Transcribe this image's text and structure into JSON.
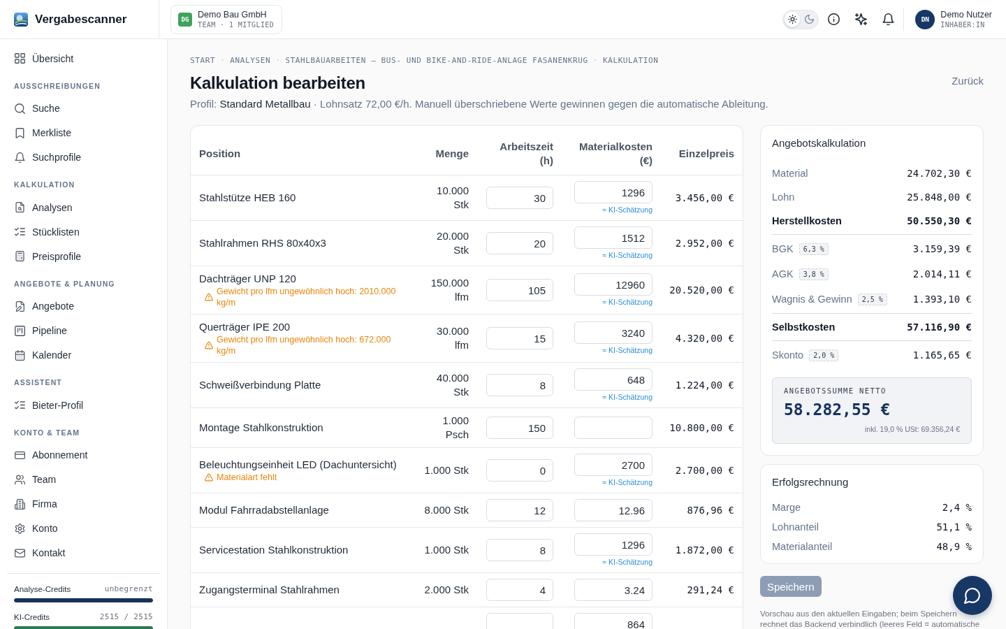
{
  "app": {
    "name": "Vergabescanner"
  },
  "org_switcher": {
    "initials": "DG",
    "name": "Demo Bau GmbH",
    "meta": "TEAM · 1 MITGLIED"
  },
  "theme_toggle": [
    {
      "kind": "light",
      "selected": true
    },
    {
      "kind": "dark",
      "selected": false
    }
  ],
  "user": {
    "initials": "DN",
    "name": "Demo Nutzer",
    "role": "INHABER:IN"
  },
  "sidebar": {
    "sections": [
      {
        "items": [
          "Übersicht"
        ]
      },
      {
        "heading": "AUSSCHREIBUNGEN",
        "items": [
          "Suche",
          "Merkliste",
          "Suchprofile"
        ]
      },
      {
        "heading": "KALKULATION",
        "items": [
          "Analysen",
          "Stücklisten",
          "Preisprofile"
        ]
      },
      {
        "heading": "ANGEBOTE & PLANUNG",
        "items": [
          "Angebote",
          "Pipeline",
          "Kalender"
        ]
      },
      {
        "heading": "ASSISTENT",
        "items": [
          "Bieter-Profil"
        ]
      },
      {
        "heading": "KONTO & TEAM",
        "items": [
          "Abonnement",
          "Team",
          "Firma",
          "Konto",
          "Kontakt"
        ]
      }
    ],
    "credits": [
      {
        "label": "Analyse-Credits",
        "value": "unbegrenzt",
        "level": 1,
        "color": "#15325e"
      },
      {
        "label": "KI-Credits",
        "value": "2515 / 2515",
        "level": 1,
        "color": "#2b7a52"
      }
    ]
  },
  "breadcrumb": {
    "separator": "·",
    "items": [
      "START",
      "ANALYSEN",
      "STAHLBAUARBEITEN — BUS- UND BIKE-AND-RIDE-ANLAGE FASANENKRUG",
      "KALKULATION"
    ]
  },
  "title": "Kalkulation bearbeiten",
  "subtitle": {
    "label": "Profil:",
    "profile": "Standard Metallbau",
    "text": "· Lohnsatz 72,00 €/h. Manuell überschriebene Werte gewinnen gegen die automatische Ableitung."
  },
  "back_link": "Zurück",
  "table": {
    "columns": [
      "Position",
      "Menge",
      "Arbeitszeit (h)",
      "Materialkosten (€)",
      "Einzelpreis"
    ],
    "rows": [
      {
        "position": "Stahlstütze HEB 160",
        "quantity": "10.000 Stk",
        "labor_hours": "30",
        "material_cost": "1296",
        "hint": "≈ KI-Schätzung",
        "unit_price": "3.456,00 €"
      },
      {
        "position": "Stahlrahmen RHS 80x40x3",
        "quantity": "20.000 Stk",
        "labor_hours": "20",
        "material_cost": "1512",
        "hint": "≈ KI-Schätzung",
        "unit_price": "2.952,00 €"
      },
      {
        "position": "Dachträger UNP 120",
        "warning": "Gewicht pro lfm ungewöhnlich hoch: 2010.000 kg/m",
        "quantity": "150.000 lfm",
        "labor_hours": "105",
        "material_cost": "12960",
        "hint": "≈ KI-Schätzung",
        "unit_price": "20.520,00 €"
      },
      {
        "position": "Querträger IPE 200",
        "warning": "Gewicht pro lfm ungewöhnlich hoch: 672.000 kg/m",
        "quantity": "30.000 lfm",
        "labor_hours": "15",
        "material_cost": "3240",
        "hint": "≈ KI-Schätzung",
        "unit_price": "4.320,00 €"
      },
      {
        "position": "Schweißverbindung Platte",
        "quantity": "40.000 Stk",
        "labor_hours": "8",
        "material_cost": "648",
        "hint": "≈ KI-Schätzung",
        "unit_price": "1.224,00 €"
      },
      {
        "position": "Montage Stahlkonstruktion",
        "quantity": "1.000 Psch",
        "labor_hours": "150",
        "unit_price": "10.800,00 €"
      },
      {
        "position": "Beleuchtungseinheit LED (Dachuntersicht)",
        "warning": "Materialart fehlt",
        "quantity": "1.000 Stk",
        "labor_hours": "0",
        "material_cost": "2700",
        "hint": "≈ KI-Schätzung",
        "unit_price": "2.700,00 €"
      },
      {
        "position": "Modul Fahrradabstellanlage",
        "quantity": "8.000 Stk",
        "labor_hours": "12",
        "material_cost": "12.96",
        "unit_price": "876,96 €"
      },
      {
        "position": "Servicestation Stahlkonstruktion",
        "quantity": "1.000 Stk",
        "labor_hours": "8",
        "material_cost": "1296",
        "hint": "≈ KI-Schätzung",
        "unit_price": "1.872,00 €"
      },
      {
        "position": "Zugangsterminal Stahlrahmen",
        "quantity": "2.000 Stk",
        "labor_hours": "4",
        "material_cost": "3.24",
        "unit_price": "291,24 €"
      },
      {
        "material_cost": "864"
      }
    ]
  },
  "offer_calculation": {
    "title": "Angebotskalkulation",
    "groups": [
      {
        "rows": [
          {
            "kind": "item",
            "label": "Material",
            "value": "24.702,30 €"
          },
          {
            "kind": "item",
            "label": "Lohn",
            "value": "25.848,00 €"
          },
          {
            "kind": "total",
            "label": "Herstellkosten",
            "value": "50.550,30 €"
          }
        ]
      },
      {
        "rows": [
          {
            "kind": "item",
            "label": "BGK",
            "rate": "6,3 %",
            "value": "3.159,39 €"
          },
          {
            "kind": "item",
            "label": "AGK",
            "rate": "3,8 %",
            "value": "2.014,11 €"
          },
          {
            "kind": "item",
            "label": "Wagnis & Gewinn",
            "rate": "2,5 %",
            "value": "1.393,10 €"
          }
        ]
      },
      {
        "rows": [
          {
            "kind": "total",
            "label": "Selbstkosten",
            "value": "57.116,90 €"
          }
        ]
      },
      {
        "rows": [
          {
            "kind": "item",
            "label": "Skonto",
            "rate": "2,0 %",
            "value": "1.165,65 €"
          }
        ]
      }
    ],
    "net_total": {
      "label": "ANGEBOTSSUMME NETTO",
      "value": "58.282,55 €",
      "vat_note": "inkl. 19,0 % USt: 69.356,24 €"
    }
  },
  "result": {
    "title": "Erfolgsrechnung",
    "rows": [
      {
        "label": "Marge",
        "value": "2,4 %"
      },
      {
        "label": "Lohnanteil",
        "value": "51,1 %"
      },
      {
        "label": "Materialanteil",
        "value": "48,9 %"
      }
    ]
  },
  "save_button": {
    "label": "Speichern",
    "disabled": true
  },
  "save_note": "Vorschau aus den aktuellen Eingaben; beim Speichern rechnet das Backend verbindlich (leeres Feld = automatische"
}
